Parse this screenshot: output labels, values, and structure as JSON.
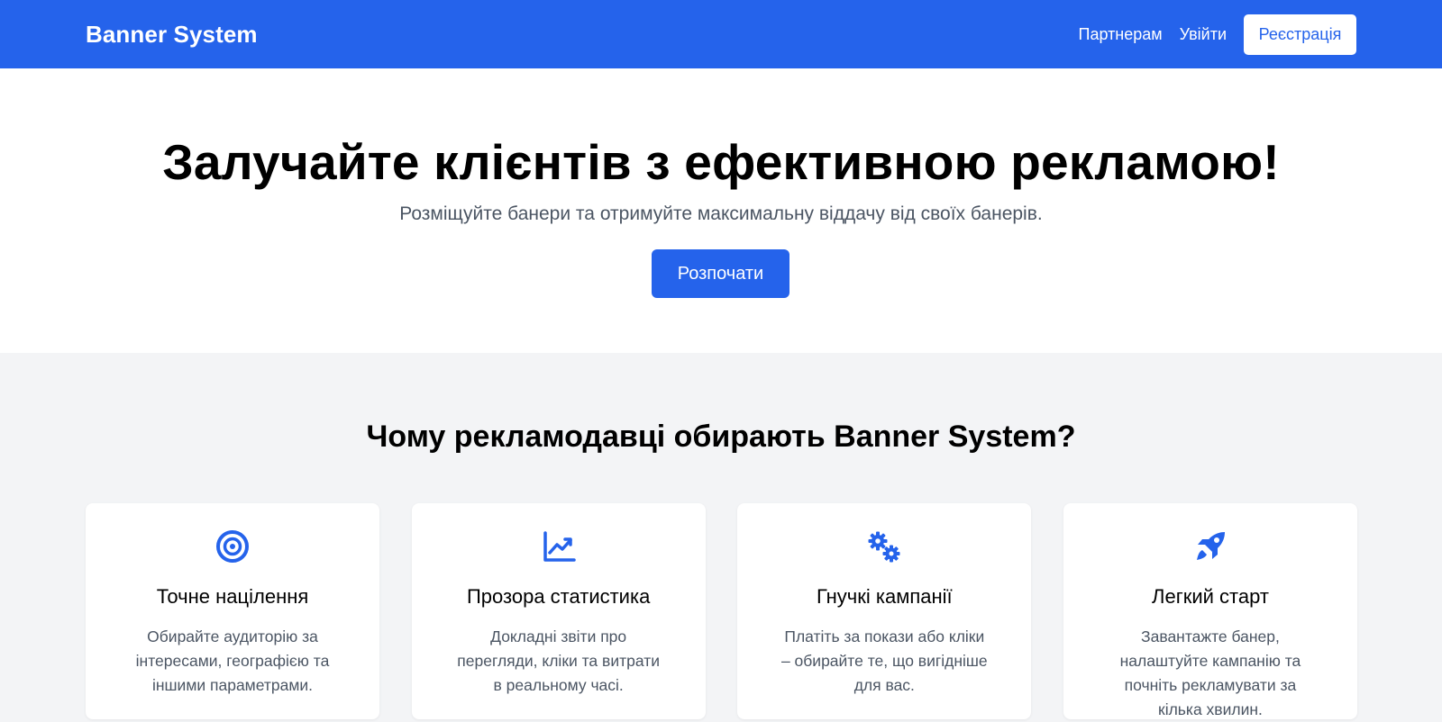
{
  "header": {
    "brand": "Banner System",
    "nav": {
      "partners": "Партнерам",
      "login": "Увійти",
      "register": "Реєстрація"
    }
  },
  "hero": {
    "title": "Залучайте клієнтів з ефективною рекламою!",
    "subtitle": "Розміщуйте банери та отримуйте максимальну віддачу від своїх банерів.",
    "cta": "Розпочати"
  },
  "features": {
    "title": "Чому рекламодавці обирають Banner System?",
    "cards": [
      {
        "icon": "target-icon",
        "title": "Точне націлення",
        "text": "Обирайте аудиторію за інтересами, географією та іншими параметрами."
      },
      {
        "icon": "chart-line-icon",
        "title": "Прозора статистика",
        "text": "Докладні звіти про перегляди, кліки та витрати в реальному часі."
      },
      {
        "icon": "gears-icon",
        "title": "Гнучкі кампанії",
        "text": "Платіть за покази або кліки – обирайте те, що вигідніше для вас."
      },
      {
        "icon": "rocket-icon",
        "title": "Легкий старт",
        "text": "Завантажте банер, налаштуйте кампанію та почніть рекламувати за кілька хвилин."
      }
    ]
  },
  "colors": {
    "primary": "#2563eb",
    "background": "#f3f4f6",
    "muted_text": "#4b5563"
  }
}
